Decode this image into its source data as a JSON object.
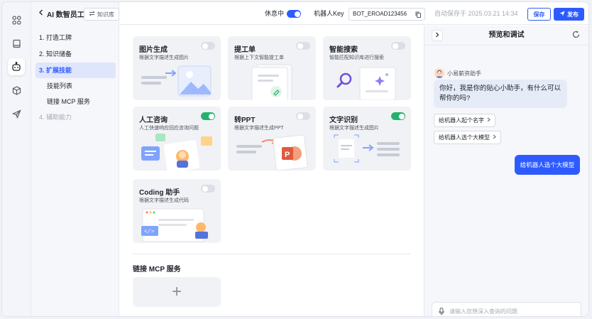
{
  "rail": {
    "icons": [
      "apps-icon",
      "book-icon",
      "robot-icon",
      "cube-icon",
      "send-icon"
    ]
  },
  "header": {
    "back_title": "AI 数智员工",
    "kb_button": "知识库",
    "rest_label": "休息中",
    "key_label": "机器人Key",
    "key_value": "BOT_EROAD123456",
    "autosave": "自动保存于 2025.03.21 14:34",
    "save": "保存",
    "publish": "发布"
  },
  "steps": [
    {
      "label": "1. 打造工牌"
    },
    {
      "label": "2. 知识储备"
    },
    {
      "label": "3. 扩展技能"
    },
    {
      "label": "技能列表"
    },
    {
      "label": "链接 MCP 服务"
    },
    {
      "label": "4. 辅助能力"
    }
  ],
  "skills": [
    {
      "title": "图片生成",
      "desc": "根据文字描述生成图片",
      "enabled": false
    },
    {
      "title": "提工单",
      "desc": "根据上下文智能提工单",
      "enabled": false
    },
    {
      "title": "智能搜索",
      "desc": "智能匹配知识库进行搜索",
      "enabled": false
    },
    {
      "title": "人工咨询",
      "desc": "人工快速响应回应咨询问题",
      "enabled": true
    },
    {
      "title": "转PPT",
      "desc": "根据文字描述生成PPT",
      "enabled": false
    },
    {
      "title": "文字识别",
      "desc": "根据文字描述生成图片",
      "enabled": true
    },
    {
      "title": "Coding 助手",
      "desc": "根据文字描述生成代码",
      "enabled": false
    }
  ],
  "mcp": {
    "title": "链接 MCP 服务",
    "add": "+"
  },
  "preview": {
    "title": "预览和调试",
    "bot_name": "小易薪资助手",
    "greeting": "你好，我是你的贴心小助手，有什么可以帮你的吗?",
    "suggestions": [
      "给机器人起个名字",
      "给机器人选个大模型"
    ],
    "user_message": "给机器人选个大模型",
    "input_placeholder": "请输入您想深入查询的问题"
  },
  "colors": {
    "accent": "#2e5bff",
    "toggle_on": "#23b26d",
    "card_bg": "#f1f2f5"
  }
}
